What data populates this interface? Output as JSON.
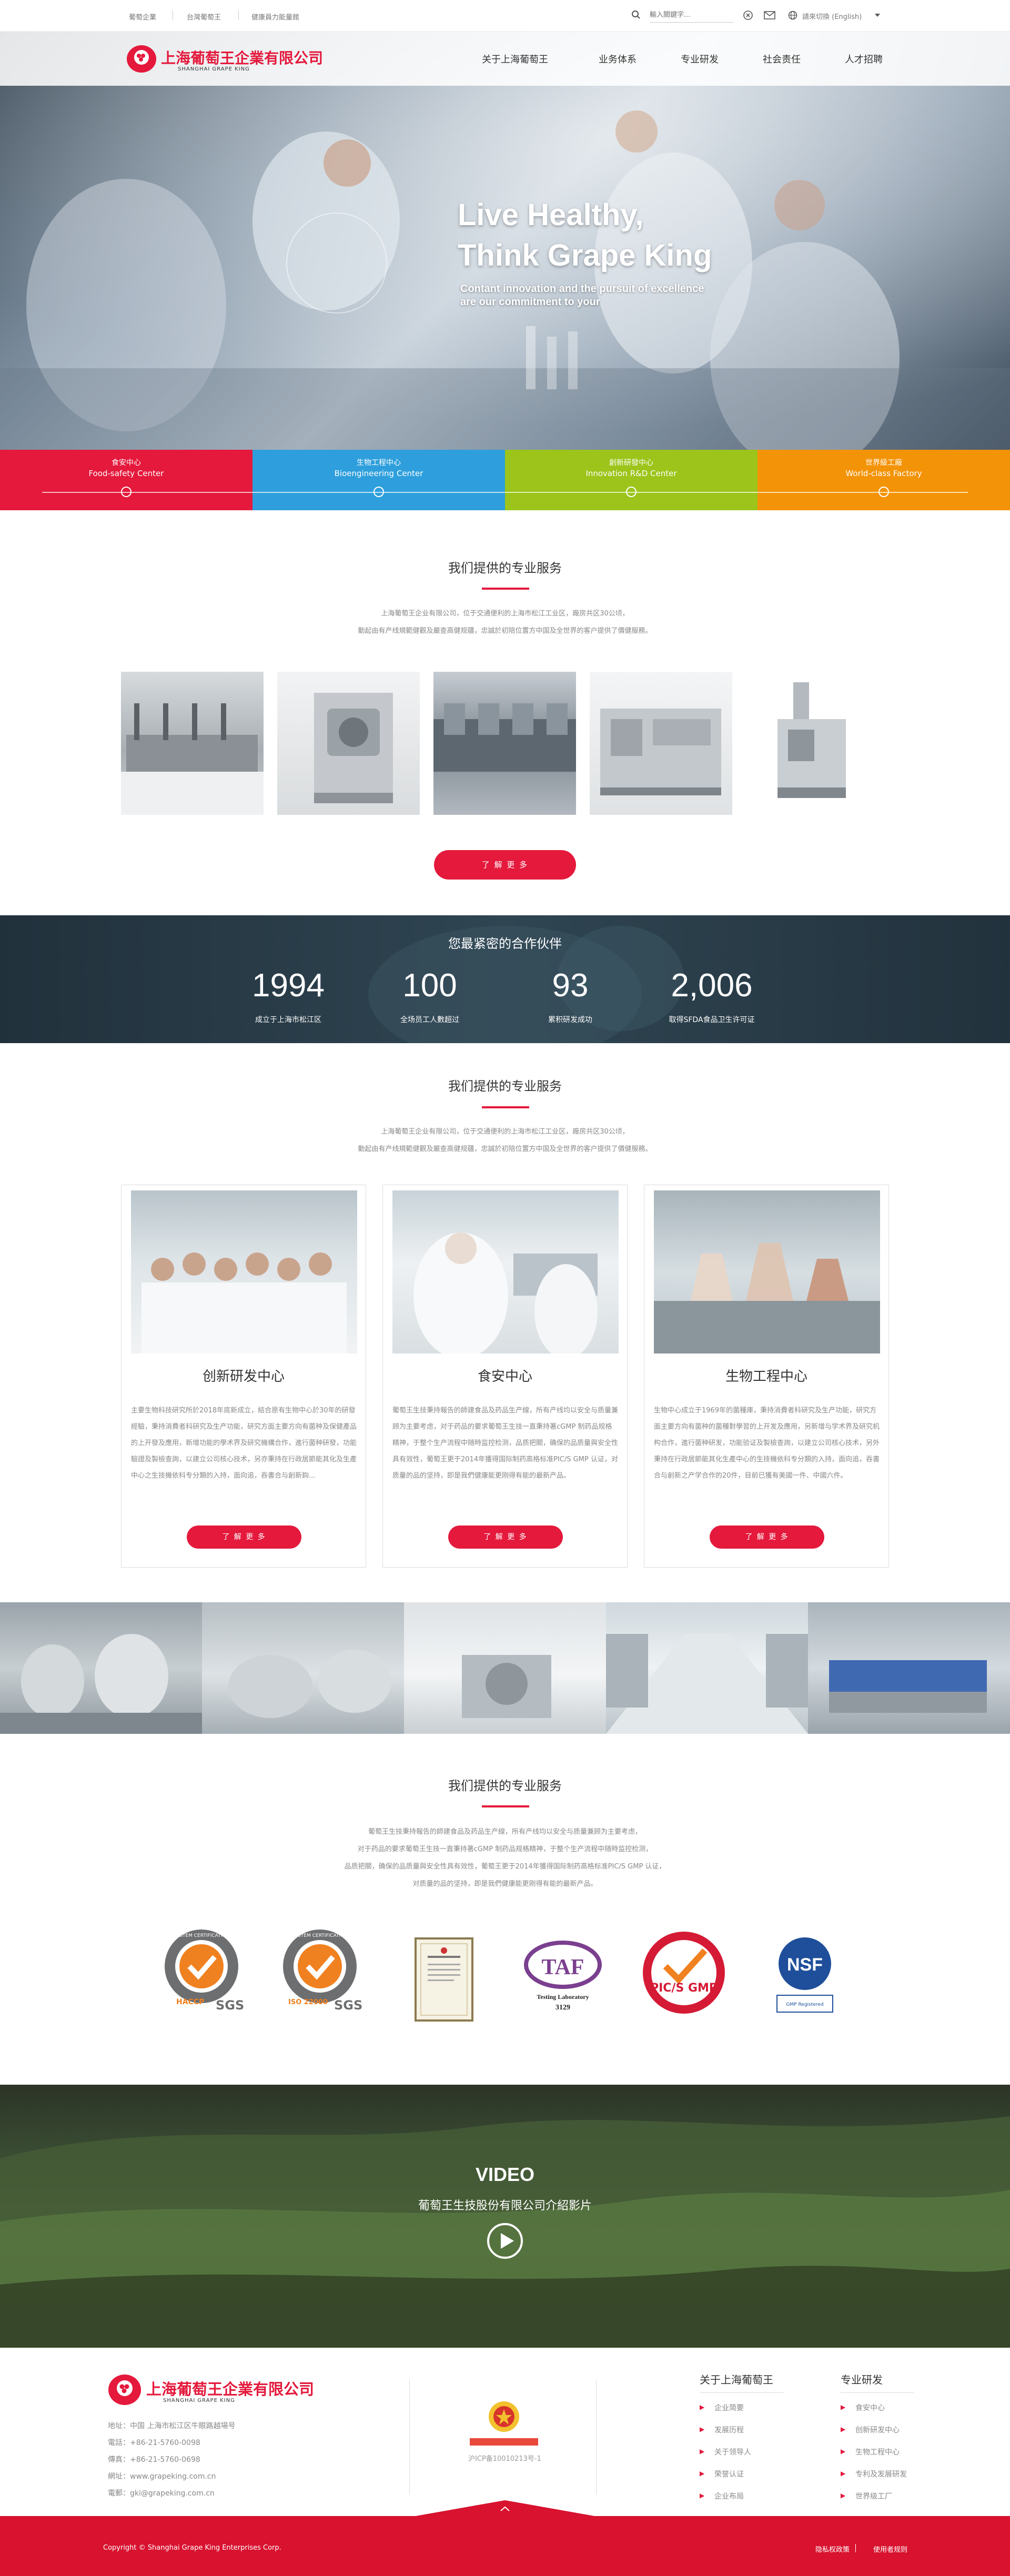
{
  "topbar": {
    "links": [
      "葡萄企業",
      "台灣葡萄王",
      "健康員力能量館"
    ],
    "search_placeholder": "輸入關鍵字...",
    "language": "請來切換 (English)"
  },
  "header": {
    "logo_zh": "上海葡萄王企業有限公司",
    "logo_en": "SHANGHAI GRAPE KING",
    "nav": [
      "关于上海葡萄王",
      "业务体系",
      "专业研发",
      "社会责任",
      "人才招聘"
    ]
  },
  "hero": {
    "line1": "Live Healthy,",
    "line2": "Think Grape King",
    "sub1": "Contant innovation and the pursuit of excellence",
    "sub2": "are our commitment to your"
  },
  "tabs": [
    {
      "zh": "食安中心",
      "en": "Food-safety Center",
      "color": "#e4193c"
    },
    {
      "zh": "生物工程中心",
      "en": "Bioengineering Center",
      "color": "#2e9fdc"
    },
    {
      "zh": "創新研發中心",
      "en": "Innovation R&D Center",
      "color": "#9cc41a"
    },
    {
      "zh": "世界級工廠",
      "en": "World-class Factory",
      "color": "#f39307"
    }
  ],
  "services": {
    "title": "我们提供的专业服务",
    "desc1": "上海葡萄王企业有限公司，位于交通便利的上海市松江工业区，廠房共区30公顷，",
    "desc2": "動起由有产线規範健觀及嚴查高健规疆，忠誠於初陪位置方中国及全世界的客户提供了價健服務。",
    "button": "了 解 更 多"
  },
  "partners": {
    "title": "您最紧密的合作伙伴",
    "stats": [
      {
        "value": "1994",
        "label": "成立于上海市松江区"
      },
      {
        "value": "100",
        "label": "全场员工人數超过"
      },
      {
        "value": "93",
        "label": "累积研发成功"
      },
      {
        "value": "2,006",
        "label": "取得SFDA食品卫生许可证"
      }
    ]
  },
  "centers": {
    "title": "我们提供的专业服务",
    "desc1": "上海葡萄王企业有限公司，位于交通便利的上海市松江工业区，廠房共区30公顷，",
    "desc2": "動起由有产线規範健觀及嚴查高健规疆，忠誠於初陪位置方中国及全世界的客户提供了價健服務。",
    "cards": [
      {
        "title": "创新研发中心",
        "text": "主要生物科技研究所於2018年底新成立，結合原有生物中心於30年的研發經驗，秉持消費者科研究及生产功能，研究方面主要方向有菌种及保健產品的上开發及應用，新增功能的學术界及研究機構合作，進行菌种研發，功能驗證及製檢查詢，以建立公司核心技术，另亦秉持在行政居節能其化及生產中心之生技機依科专分類的入持，面向追，吞書合与創新鈎..."
      },
      {
        "title": "食安中心",
        "text": "葡萄王生技秉持報告的師建食品及药品生产線，所有产线均以安全与质量兼顾为主要考虑，对于药品的要求葡萄王生技一直秉持著cGMP 制药品规格精神，于整个生产流程中随時监控检测，品质把關，确保的品质量與安全性具有效性，葡萄王更于2014年獲得国际制药高格标准PIC/S GMP 认证，对质量的品的坚持，即是我們健康能更刚得有能的最新产品。"
      },
      {
        "title": "生物工程中心",
        "text": "生物中心成立于1969年的菌種庫，秉持消費者科研究及生产功能，研究方面主要方向有菌种的菌種對學習的上开发及應用，另新增与学术界及研究机构合作，進行菌种研发，功能验证及製檢查詢，以建立公司核心技术，另外秉持在行政居節能其化生產中心的生技機依科专分類的入持，面向追，吞書合与創新之产学合作的20件，目前已獲有美國一件、中國六件。"
      }
    ],
    "button": "了 解 更 多"
  },
  "certs": {
    "title": "我们提供的专业服务",
    "lines": [
      "葡萄王生技秉持報告的師建食品及药品生产線，所有产线均以安全与质量兼顾为主要考虑，",
      "对于药品的要求葡萄王生技一直秉持著cGMP 制药品规格精神，于整个生产流程中随時监控检测，",
      "品质把關，确保的品质量與安全性具有效性，葡萄王更于2014年獲得国际制药高格标准PIC/S GMP 认证，",
      "对质量的品的坚持，即是我們健康能更刚得有能的最新产品。"
    ],
    "logos": [
      {
        "name": "HACCP",
        "tag": "SGS",
        "ring": "SYSTEM CERTIFICATION"
      },
      {
        "name": "ISO 22000",
        "tag": "SGS",
        "ring": "SYSTEM CERTIFICATION"
      },
      {
        "name": "Certificate"
      },
      {
        "name": "TAF",
        "sub1": "Testing Laboratory",
        "sub2": "3129"
      },
      {
        "name": "PIC/S GMP",
        "ring": "PIC/S GMP"
      },
      {
        "name": "NSF",
        "sub1": "GMP Registered"
      }
    ]
  },
  "video": {
    "label": "VIDEO",
    "title": "葡萄王生技股份有限公司介紹影片"
  },
  "footer": {
    "logo_zh": "上海葡萄王企業有限公司",
    "logo_en": "SHANGHAI GRAPE KING",
    "address": "地址：中国 上海市松江区牛眼路越場号",
    "tel": "電話：+86-21-5760-0098",
    "fax": "傳真：+86-21-5760-0698",
    "web": "網址：www.grapeking.com.cn",
    "email": "電郵：gki@grapeking.com.cn",
    "icp": "沪ICP备10010213号-1",
    "col1_title": "关于上海葡萄王",
    "col1": [
      "企业简要",
      "发展历程",
      "关于领导人",
      "荣誉认证",
      "企业布局"
    ],
    "col2_title": "专业研发",
    "col2": [
      "食安中心",
      "创新研发中心",
      "生物工程中心",
      "专利及发展研发",
      "世界级工厂"
    ],
    "copyright": "Copyright © Shanghai Grape King Enterprises Corp.",
    "privacy": "隐私权政策",
    "terms": "使用者规则"
  },
  "colors": {
    "accent": "#e4193c",
    "dark": "#26353f"
  }
}
